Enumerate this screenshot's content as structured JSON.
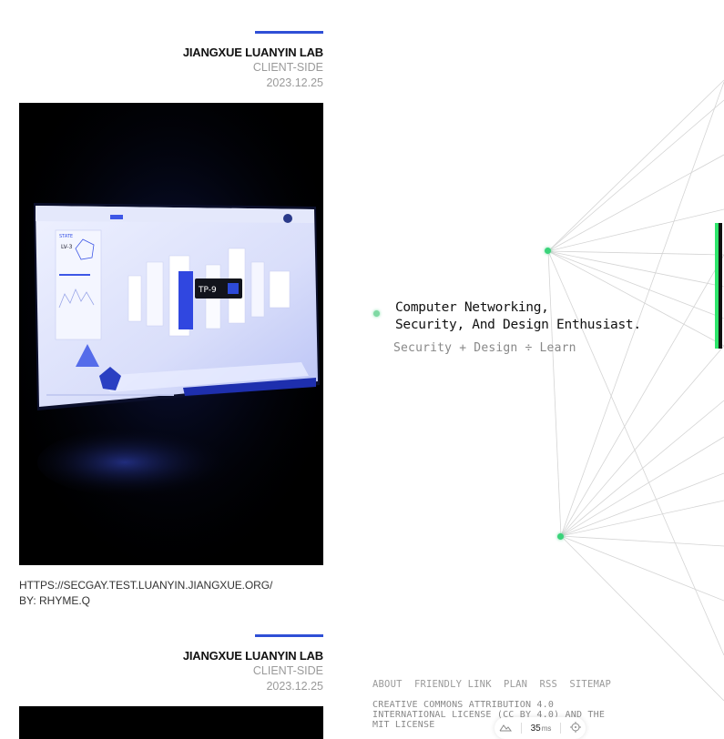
{
  "posts": [
    {
      "title": "JIANGXUE LUANYIN LAB",
      "category": "CLIENT-SIDE",
      "date": "2023.12.25",
      "screen_labels": {
        "state": "STATE",
        "level": "LV-3",
        "tag": "TP-9"
      },
      "url": "HTTPS://SECGAY.TEST.LUANYIN.JIANGXUE.ORG/",
      "author": "BY: RHYME.Q"
    },
    {
      "title": "JIANGXUE LUANYIN LAB",
      "category": "CLIENT-SIDE",
      "date": "2023.12.25"
    }
  ],
  "hero": {
    "line1": "Computer Networking,",
    "line2": "Security, And Design Enthusiast.",
    "subtitle": "Security + Design ÷ Learn"
  },
  "footer": {
    "links": [
      "ABOUT",
      "FRIENDLY LINK",
      "PLAN",
      "RSS",
      "SITEMAP"
    ],
    "license": "CREATIVE COMMONS ATTRIBUTION 4.0 INTERNATIONAL LICENSE (CC BY 4.0) AND THE MIT LICENSE"
  },
  "status_pill": {
    "latency_value": "35",
    "latency_unit": "ms",
    "left_icon": "mountain-icon",
    "right_icon": "crosshair-icon"
  },
  "colors": {
    "accent_blue": "#2f4fd6",
    "node_green": "#3ad37a",
    "bar_green": "#2ee56b"
  }
}
